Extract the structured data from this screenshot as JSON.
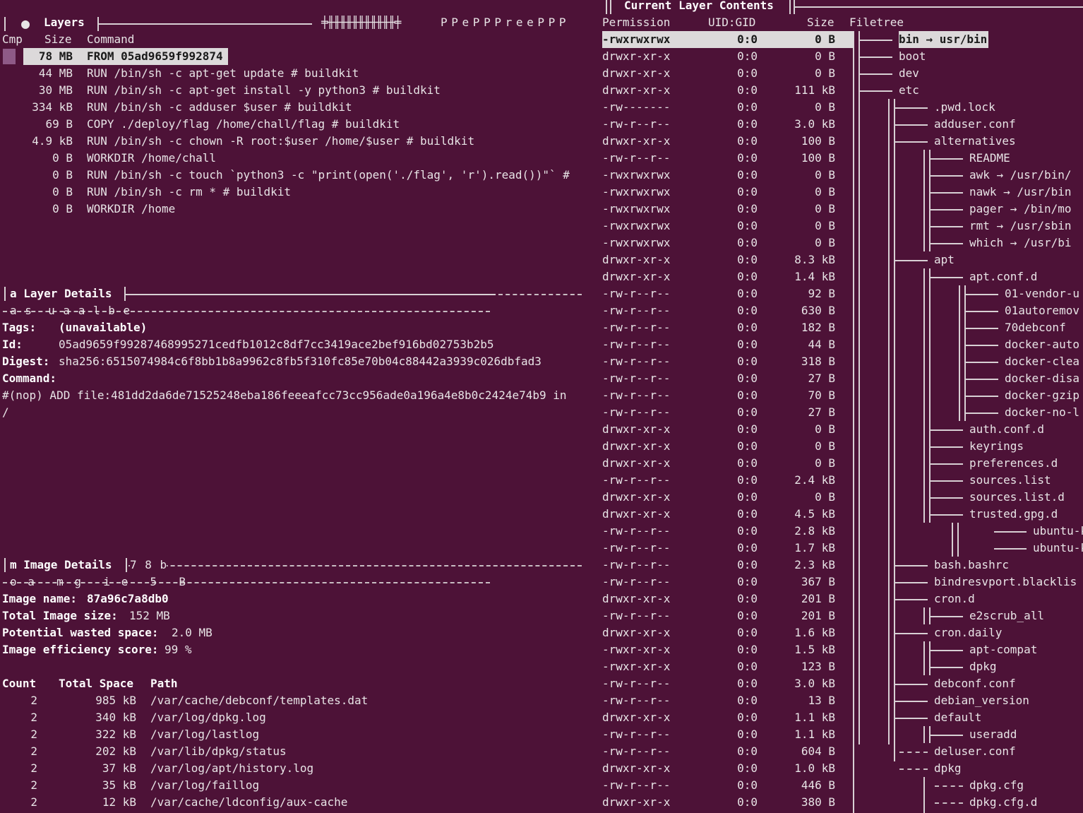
{
  "layers_panel": {
    "title": "Layers",
    "header_tail": "P P e P P P r e e P P P",
    "columns": {
      "cmp": "Cmp",
      "size": "Size",
      "command": "Command"
    },
    "rows": [
      {
        "size": "78 MB",
        "command": "FROM 05ad9659f992874"
      },
      {
        "size": "44 MB",
        "command": "RUN /bin/sh -c apt-get update # buildkit"
      },
      {
        "size": "30 MB",
        "command": "RUN /bin/sh -c apt-get install -y python3 # buildkit"
      },
      {
        "size": "334 kB",
        "command": "RUN /bin/sh -c adduser $user # buildkit"
      },
      {
        "size": "69 B",
        "command": "COPY ./deploy/flag /home/chall/flag # buildkit"
      },
      {
        "size": "4.9 kB",
        "command": "RUN /bin/sh -c chown -R root:$user /home/$user # buildkit"
      },
      {
        "size": "0 B",
        "command": "WORKDIR /home/chall"
      },
      {
        "size": "0 B",
        "command": "RUN /bin/sh -c touch `python3 -c \"print(open('./flag', 'r').read())\"` #"
      },
      {
        "size": "0 B",
        "command": "RUN /bin/sh -c rm * # buildkit"
      },
      {
        "size": "0 B",
        "command": "WORKDIR /home"
      }
    ]
  },
  "layer_details": {
    "title": "a Layer Details",
    "subheader": "a s  u a a l b e",
    "tags_label": "Tags:",
    "tags_value": "(unavailable)",
    "id_label": "Id:",
    "id_value": "05ad9659f99287468995271cedfb1012c8df7cc3419ace2bef916bd02753b2b5",
    "digest_label": "Digest:",
    "digest_value": "sha256:6515074984c6f8bb1b8a9962c8fb5f310fc85e70b04c88442a3939c026dbfad3",
    "command_label": "Command:",
    "command_line1": "#(nop) ADD file:481dd2da6de71525248eba186feeeafcc73cc956ade0a196a4e8b0c2424e74b9 in",
    "command_line2": "/"
  },
  "image_details": {
    "title": "m Image Details",
    "title_tail": "7 8 b",
    "subheader": "o a  m g  i e  5  B",
    "name_label": "Image name:",
    "name_value": "87a96c7a8db0",
    "size_label": "Total Image size:",
    "size_value": "152 MB",
    "wasted_label": "Potential wasted space:",
    "wasted_value": "2.0 MB",
    "efficiency_label": "Image efficiency score:",
    "efficiency_value": "99 %",
    "columns": {
      "count": "Count",
      "total": "Total Space",
      "path": "Path"
    },
    "rows": [
      {
        "count": "2",
        "total": "985 kB",
        "path": "/var/cache/debconf/templates.dat"
      },
      {
        "count": "2",
        "total": "340 kB",
        "path": "/var/log/dpkg.log"
      },
      {
        "count": "2",
        "total": "322 kB",
        "path": "/var/log/lastlog"
      },
      {
        "count": "2",
        "total": "202 kB",
        "path": "/var/lib/dpkg/status"
      },
      {
        "count": "2",
        "total": "37 kB",
        "path": "/var/log/apt/history.log"
      },
      {
        "count": "2",
        "total": "35 kB",
        "path": "/var/log/faillog"
      },
      {
        "count": "2",
        "total": "12 kB",
        "path": "/var/cache/ldconfig/aux-cache"
      }
    ]
  },
  "contents_panel": {
    "title": "Current Layer Contents",
    "columns": {
      "perm": "Permission",
      "uid": "UID:GID",
      "size": "Size",
      "tree": "Filetree"
    },
    "rows": [
      {
        "perm": "-rwxrwxrwx",
        "uid": "0:0",
        "size": "0 B",
        "name": "bin → usr/bin",
        "depth": 0,
        "selected": true
      },
      {
        "perm": "drwxr-xr-x",
        "uid": "0:0",
        "size": "0 B",
        "name": "boot",
        "depth": 0
      },
      {
        "perm": "drwxr-xr-x",
        "uid": "0:0",
        "size": "0 B",
        "name": "dev",
        "depth": 0
      },
      {
        "perm": "drwxr-xr-x",
        "uid": "0:0",
        "size": "111 kB",
        "name": "etc",
        "depth": 0
      },
      {
        "perm": "-rw-------",
        "uid": "0:0",
        "size": "0 B",
        "name": ".pwd.lock",
        "depth": 1
      },
      {
        "perm": "-rw-r--r--",
        "uid": "0:0",
        "size": "3.0 kB",
        "name": "adduser.conf",
        "depth": 1
      },
      {
        "perm": "drwxr-xr-x",
        "uid": "0:0",
        "size": "100 B",
        "name": "alternatives",
        "depth": 1
      },
      {
        "perm": "-rw-r--r--",
        "uid": "0:0",
        "size": "100 B",
        "name": "README",
        "depth": 2
      },
      {
        "perm": "-rwxrwxrwx",
        "uid": "0:0",
        "size": "0 B",
        "name": "awk → /usr/bin/",
        "depth": 2
      },
      {
        "perm": "-rwxrwxrwx",
        "uid": "0:0",
        "size": "0 B",
        "name": "nawk → /usr/bin",
        "depth": 2
      },
      {
        "perm": "-rwxrwxrwx",
        "uid": "0:0",
        "size": "0 B",
        "name": "pager → /bin/mo",
        "depth": 2
      },
      {
        "perm": "-rwxrwxrwx",
        "uid": "0:0",
        "size": "0 B",
        "name": "rmt → /usr/sbin",
        "depth": 2
      },
      {
        "perm": "-rwxrwxrwx",
        "uid": "0:0",
        "size": "0 B",
        "name": "which → /usr/bi",
        "depth": 2
      },
      {
        "perm": "drwxr-xr-x",
        "uid": "0:0",
        "size": "8.3 kB",
        "name": "apt",
        "depth": 1
      },
      {
        "perm": "drwxr-xr-x",
        "uid": "0:0",
        "size": "1.4 kB",
        "name": "apt.conf.d",
        "depth": 2
      },
      {
        "perm": "-rw-r--r--",
        "uid": "0:0",
        "size": "92 B",
        "name": "01-vendor-u",
        "depth": 3
      },
      {
        "perm": "-rw-r--r--",
        "uid": "0:0",
        "size": "630 B",
        "name": "01autoremov",
        "depth": 3
      },
      {
        "perm": "-rw-r--r--",
        "uid": "0:0",
        "size": "182 B",
        "name": "70debconf",
        "depth": 3
      },
      {
        "perm": "-rw-r--r--",
        "uid": "0:0",
        "size": "44 B",
        "name": "docker-auto",
        "depth": 3
      },
      {
        "perm": "-rw-r--r--",
        "uid": "0:0",
        "size": "318 B",
        "name": "docker-clea",
        "depth": 3
      },
      {
        "perm": "-rw-r--r--",
        "uid": "0:0",
        "size": "27 B",
        "name": "docker-disa",
        "depth": 3
      },
      {
        "perm": "-rw-r--r--",
        "uid": "0:0",
        "size": "70 B",
        "name": "docker-gzip",
        "depth": 3
      },
      {
        "perm": "-rw-r--r--",
        "uid": "0:0",
        "size": "27 B",
        "name": "docker-no-l",
        "depth": 3
      },
      {
        "perm": "drwxr-xr-x",
        "uid": "0:0",
        "size": "0 B",
        "name": "auth.conf.d",
        "depth": 2
      },
      {
        "perm": "drwxr-xr-x",
        "uid": "0:0",
        "size": "0 B",
        "name": "keyrings",
        "depth": 2
      },
      {
        "perm": "drwxr-xr-x",
        "uid": "0:0",
        "size": "0 B",
        "name": "preferences.d",
        "depth": 2
      },
      {
        "perm": "-rw-r--r--",
        "uid": "0:0",
        "size": "2.4 kB",
        "name": "sources.list",
        "depth": 2
      },
      {
        "perm": "drwxr-xr-x",
        "uid": "0:0",
        "size": "0 B",
        "name": "sources.list.d",
        "depth": 2
      },
      {
        "perm": "drwxr-xr-x",
        "uid": "0:0",
        "size": "4.5 kB",
        "name": "trusted.gpg.d",
        "depth": 2
      },
      {
        "perm": "-rw-r--r--",
        "uid": "0:0",
        "size": "2.8 kB",
        "name": "ubuntu-keyri",
        "depth": 3.8
      },
      {
        "perm": "-rw-r--r--",
        "uid": "0:0",
        "size": "1.7 kB",
        "name": "ubuntu-keyri",
        "depth": 3.8
      },
      {
        "perm": "-rw-r--r--",
        "uid": "0:0",
        "size": "2.3 kB",
        "name": "bash.bashrc",
        "depth": 1
      },
      {
        "perm": "-rw-r--r--",
        "uid": "0:0",
        "size": "367 B",
        "name": "bindresvport.blacklis",
        "depth": 1
      },
      {
        "perm": "drwxr-xr-x",
        "uid": "0:0",
        "size": "201 B",
        "name": "cron.d",
        "depth": 1
      },
      {
        "perm": "-rw-r--r--",
        "uid": "0:0",
        "size": "201 B",
        "name": "e2scrub_all",
        "depth": 2
      },
      {
        "perm": "drwxr-xr-x",
        "uid": "0:0",
        "size": "1.6 kB",
        "name": "cron.daily",
        "depth": 1
      },
      {
        "perm": "-rwxr-xr-x",
        "uid": "0:0",
        "size": "1.5 kB",
        "name": "apt-compat",
        "depth": 2
      },
      {
        "perm": "-rwxr-xr-x",
        "uid": "0:0",
        "size": "123 B",
        "name": "dpkg",
        "depth": 2
      },
      {
        "perm": "-rw-r--r--",
        "uid": "0:0",
        "size": "3.0 kB",
        "name": "debconf.conf",
        "depth": 1
      },
      {
        "perm": "-rw-r--r--",
        "uid": "0:0",
        "size": "13 B",
        "name": "debian_version",
        "depth": 1
      },
      {
        "perm": "drwxr-xr-x",
        "uid": "0:0",
        "size": "1.1 kB",
        "name": "default",
        "depth": 1
      },
      {
        "perm": "-rw-r--r--",
        "uid": "0:0",
        "size": "1.1 kB",
        "name": "useradd",
        "depth": 2
      },
      {
        "perm": "-rw-r--r--",
        "uid": "0:0",
        "size": "604 B",
        "name": "deluser.conf",
        "depth": 1,
        "dashed": true
      },
      {
        "perm": "drwxr-xr-x",
        "uid": "0:0",
        "size": "1.0 kB",
        "name": "dpkg",
        "depth": 1,
        "dashed": true
      },
      {
        "perm": "-rw-r--r--",
        "uid": "0:0",
        "size": "446 B",
        "name": "dpkg.cfg",
        "depth": 2,
        "dashed": true
      },
      {
        "perm": "drwxr-xr-x",
        "uid": "0:0",
        "size": "380 B",
        "name": "dpkg.cfg.d",
        "depth": 2,
        "dashed": true
      }
    ]
  },
  "colors": {
    "background": "#4d1237",
    "selection": "#dcd9da",
    "marker": "#8e5a87"
  }
}
